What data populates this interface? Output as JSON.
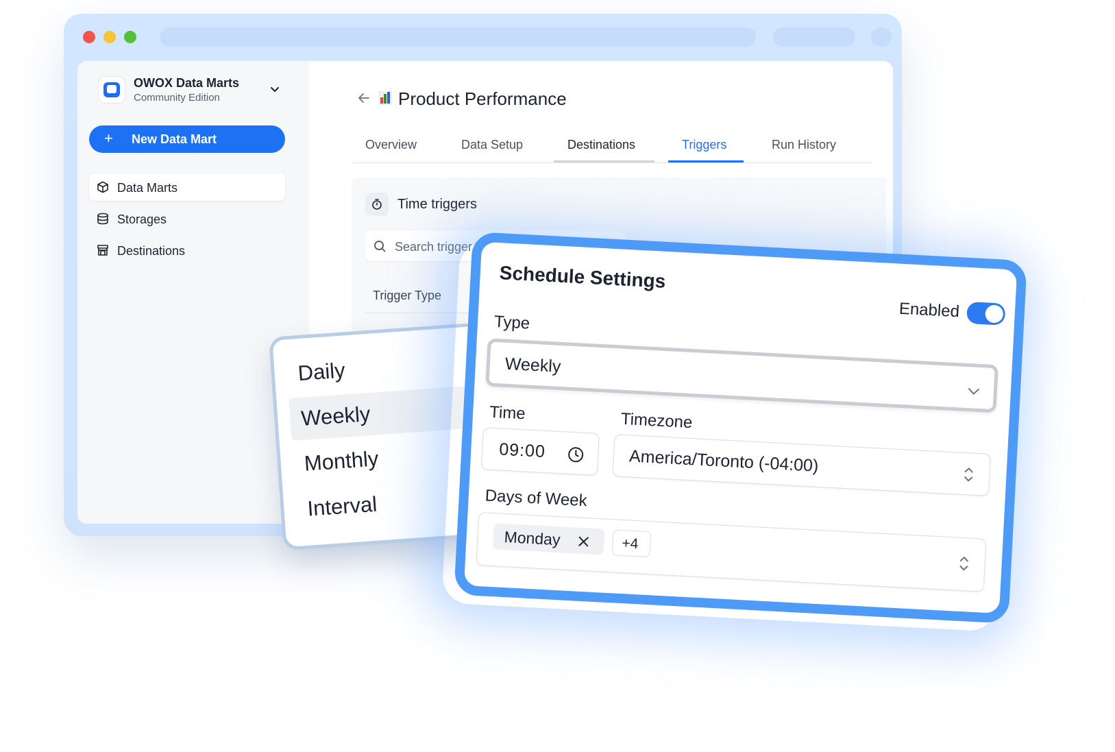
{
  "sidebar": {
    "brand_name": "OWOX Data Marts",
    "brand_sub": "Community Edition",
    "new_button": "New Data Mart",
    "items": [
      {
        "label": "Data Marts",
        "icon": "cube-icon",
        "active": true
      },
      {
        "label": "Storages",
        "icon": "database-icon",
        "active": false
      },
      {
        "label": "Destinations",
        "icon": "store-icon",
        "active": false
      }
    ]
  },
  "header": {
    "title": "Product Performance",
    "title_icon": "bar-chart-emoji"
  },
  "tabs": [
    {
      "label": "Overview"
    },
    {
      "label": "Data Setup"
    },
    {
      "label": "Destinations"
    },
    {
      "label": "Triggers",
      "active": true
    },
    {
      "label": "Run History"
    }
  ],
  "triggers": {
    "section_title": "Time triggers",
    "search_placeholder": "Search triggers...",
    "visible_search_text": "Search trigger",
    "column_header": "Trigger Type"
  },
  "type_dropdown": {
    "options": [
      "Daily",
      "Weekly",
      "Monthly",
      "Interval"
    ],
    "selected": "Weekly"
  },
  "schedule": {
    "title": "Schedule Settings",
    "enabled_label": "Enabled",
    "enabled": true,
    "type_label": "Type",
    "type_value": "Weekly",
    "time_label": "Time",
    "time_value": "09:00",
    "timezone_label": "Timezone",
    "timezone_value": "America/Toronto (-04:00)",
    "days_label": "Days of Week",
    "days_chip": "Monday",
    "days_more": "+4"
  },
  "colors": {
    "accent": "#1d72f3",
    "card_border": "#4d9bf6",
    "window_frame": "#d3e6ff"
  }
}
